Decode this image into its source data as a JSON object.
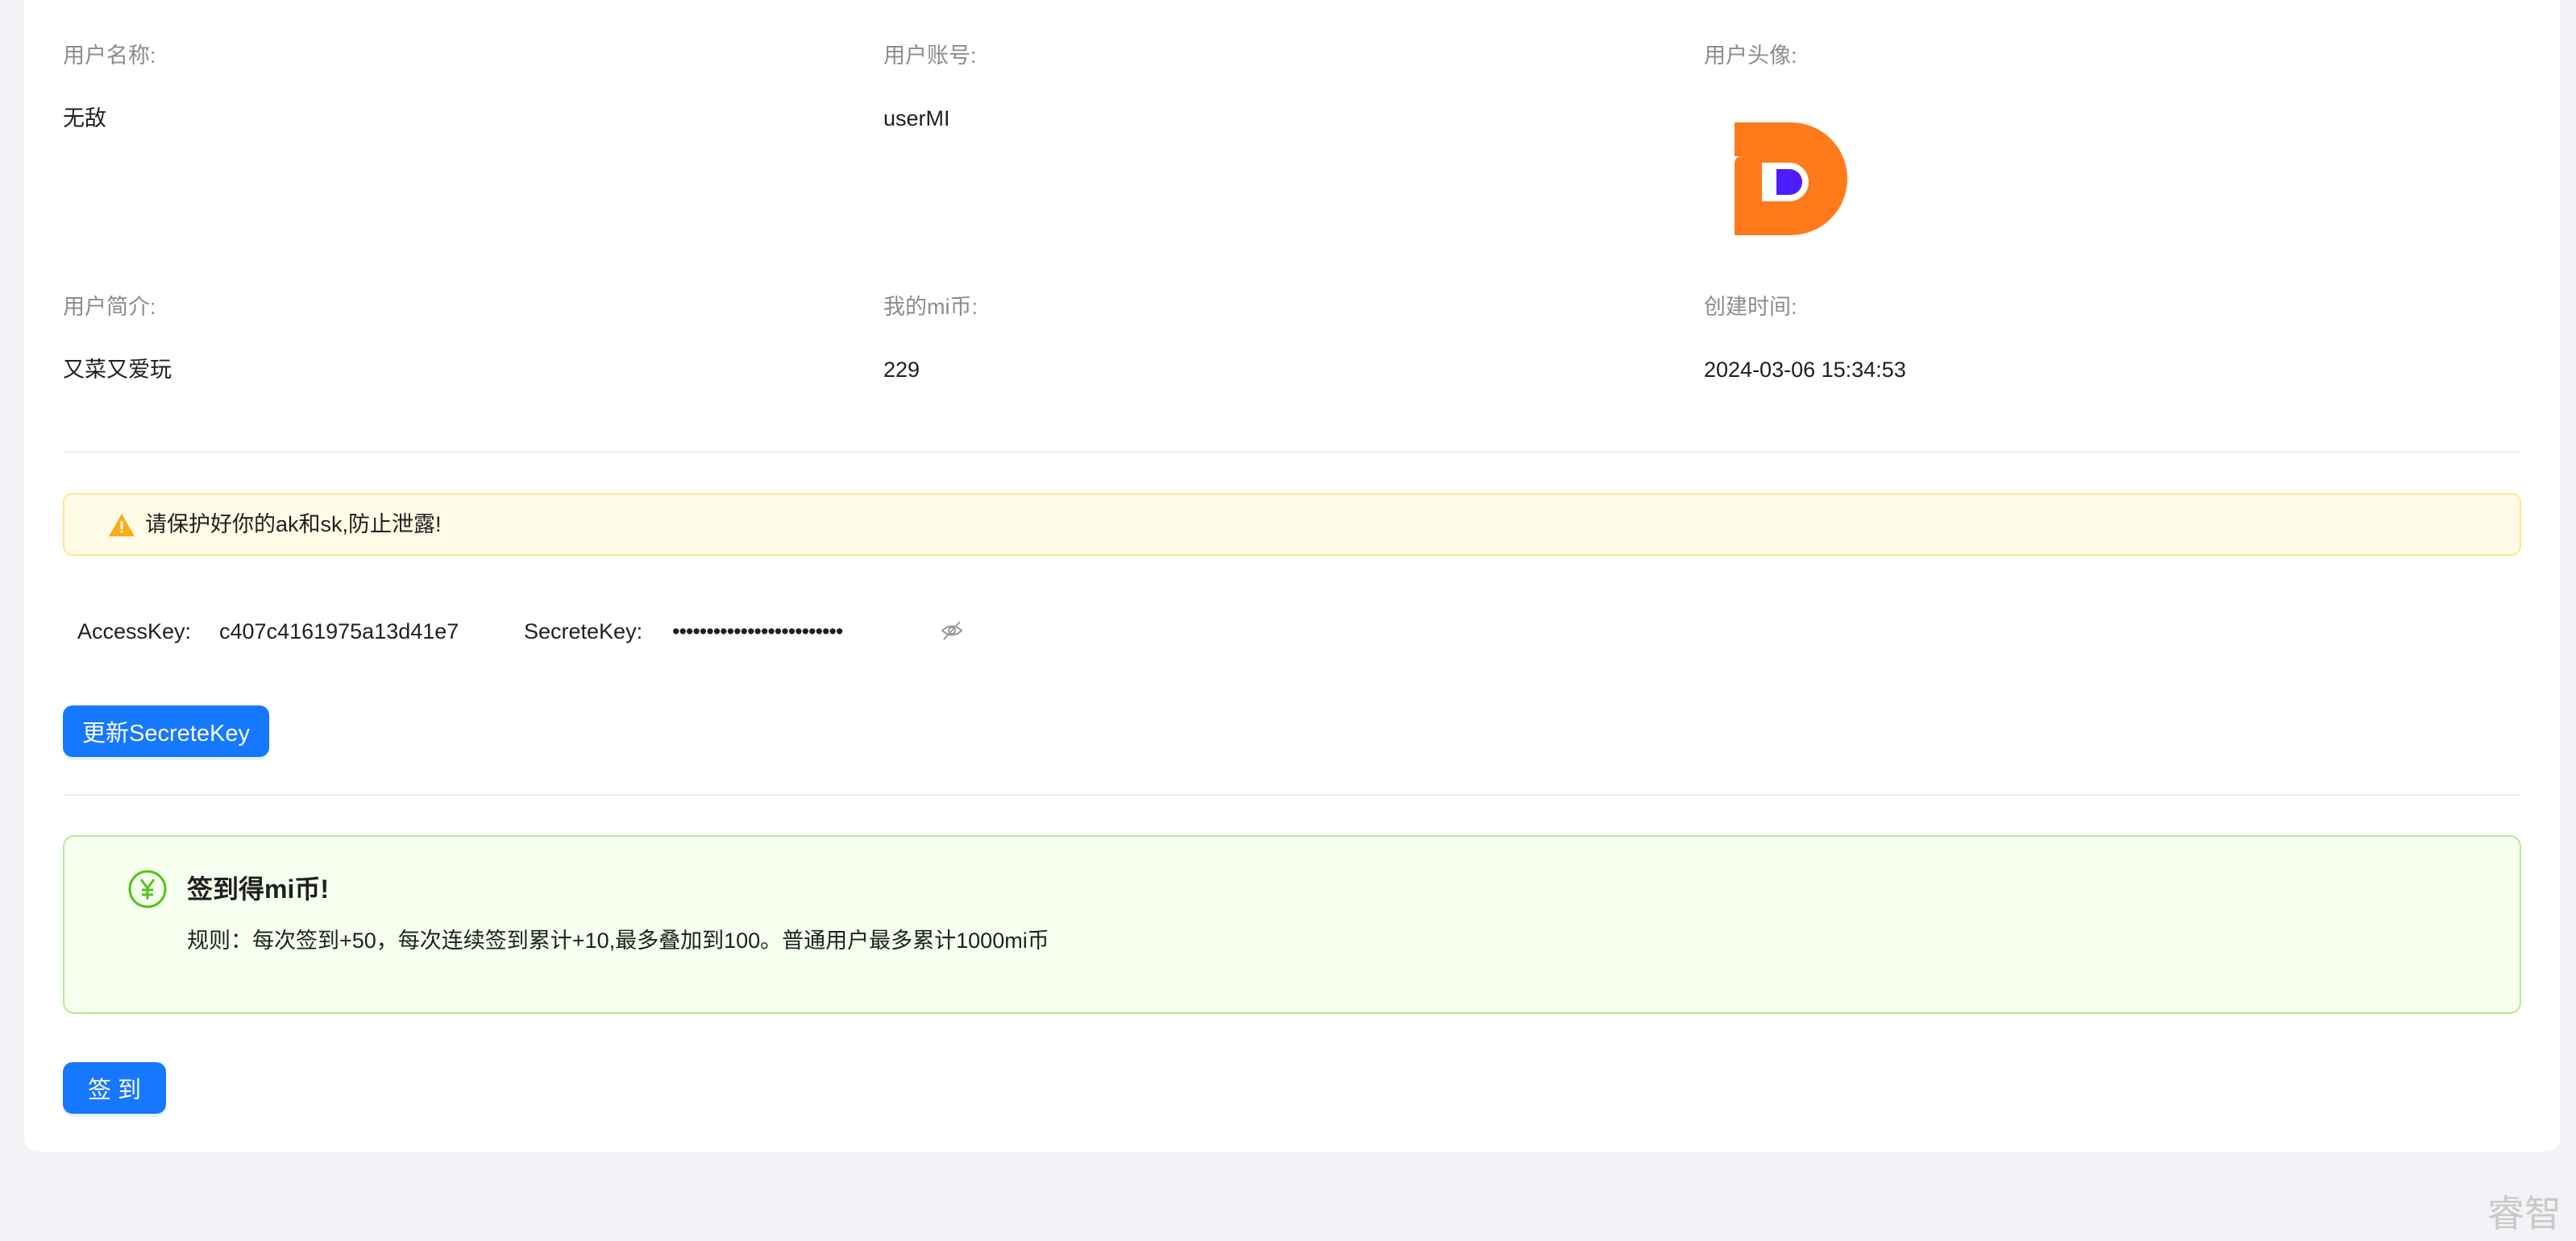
{
  "profile": {
    "username_label": "用户名称:",
    "username_value": "无敌",
    "account_label": "用户账号:",
    "account_value": "userMI",
    "avatar_label": "用户头像:",
    "intro_label": "用户简介:",
    "intro_value": "又菜又爱玩",
    "coins_label": "我的mi币:",
    "coins_value": "229",
    "created_label": "创建时间:",
    "created_value": "2024-03-06 15:34:53"
  },
  "warning": {
    "text": "请保护好你的ak和sk,防止泄露!",
    "icon": "warning-icon"
  },
  "keys": {
    "access_label": "AccessKey:",
    "access_value": "c407c4161975a13d41e7",
    "secret_label": "SecreteKey:",
    "secret_value": "•••••••••••••••••••••••••",
    "toggle_icon": "eye-invisible-icon"
  },
  "buttons": {
    "refresh_secret": "更新SecreteKey",
    "sign_in": "签 到"
  },
  "signin": {
    "title": "签到得mi币!",
    "rule": "规则：每次签到+50，每次连续签到累计+10,最多叠加到100。普通用户最多累计1000mi币",
    "icon": "yen-circle-icon"
  },
  "watermark": "睿智",
  "colors": {
    "primary": "#1677ff",
    "warning_bg": "#fffbe6",
    "warning_border": "#ffe58f",
    "success_bg": "#f6ffed",
    "success_border": "#b7eb8f",
    "avatar_orange": "#ff7a1a",
    "avatar_purple": "#4c1cff"
  }
}
